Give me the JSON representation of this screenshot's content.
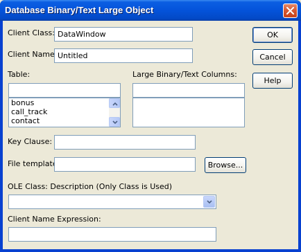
{
  "window": {
    "title": "Database Binary/Text Large Object",
    "close_icon": "close-icon"
  },
  "form": {
    "client_class_label": "Client Class:",
    "client_class_value": "DataWindow",
    "client_name_label": "Client Name:",
    "client_name_value": "Untitled",
    "table_label": "Table:",
    "table_filter_value": "",
    "table_items": [
      "bonus",
      "call_track",
      "contact"
    ],
    "large_columns_label": "Large Binary/Text Columns:",
    "large_columns_filter_value": "",
    "key_clause_label": "Key Clause:",
    "key_clause_value": "",
    "file_template_label": "File template:",
    "file_template_value": "",
    "browse_label": "Browse...",
    "ole_class_label": "OLE Class: Description (Only Class is Used)",
    "ole_class_value": "",
    "client_name_expr_label": "Client Name Expression:",
    "client_name_expr_value": ""
  },
  "buttons": {
    "ok": "OK",
    "cancel": "Cancel",
    "help": "Help"
  }
}
